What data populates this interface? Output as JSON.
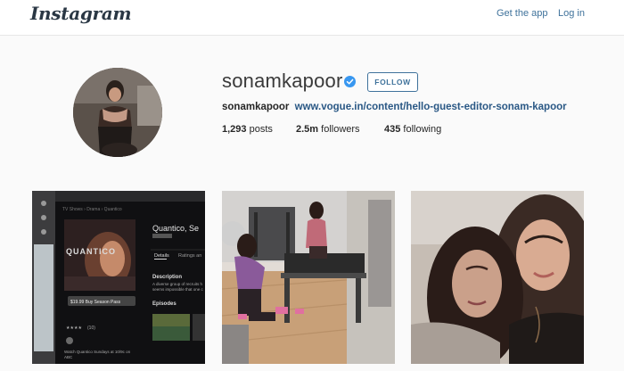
{
  "header": {
    "logo": "Instagram",
    "get_app": "Get the app",
    "log_in": "Log in"
  },
  "profile": {
    "username": "sonamkapoor",
    "follow_label": "FOLLOW",
    "bio_name": "sonamkapoor",
    "bio_link": "www.vogue.in/content/hello-guest-editor-sonam-kapoor",
    "stats": {
      "posts_count": "1,293",
      "posts_label": "posts",
      "followers_count": "2.5m",
      "followers_label": "followers",
      "following_count": "435",
      "following_label": "following"
    }
  },
  "posts": [
    {
      "title": "Quantico, Se",
      "wordmark": "QUANTICO",
      "tab_details": "Details",
      "tab_ratings": "Ratings an",
      "heading": "Description",
      "desc_1": "A diverse group of recruits h",
      "desc_2": "seems impossible that one c",
      "price_button": "$19.99 Buy Season Pass",
      "episodes": "Episodes",
      "rating_count": "(10)",
      "footer_1": "Watch Quantico Sundays at 10/9c on",
      "footer_2": "ABC"
    },
    {},
    {}
  ],
  "colors": {
    "accent": "#3f729b",
    "verified": "#3897f0",
    "logo": "#2a3744"
  }
}
